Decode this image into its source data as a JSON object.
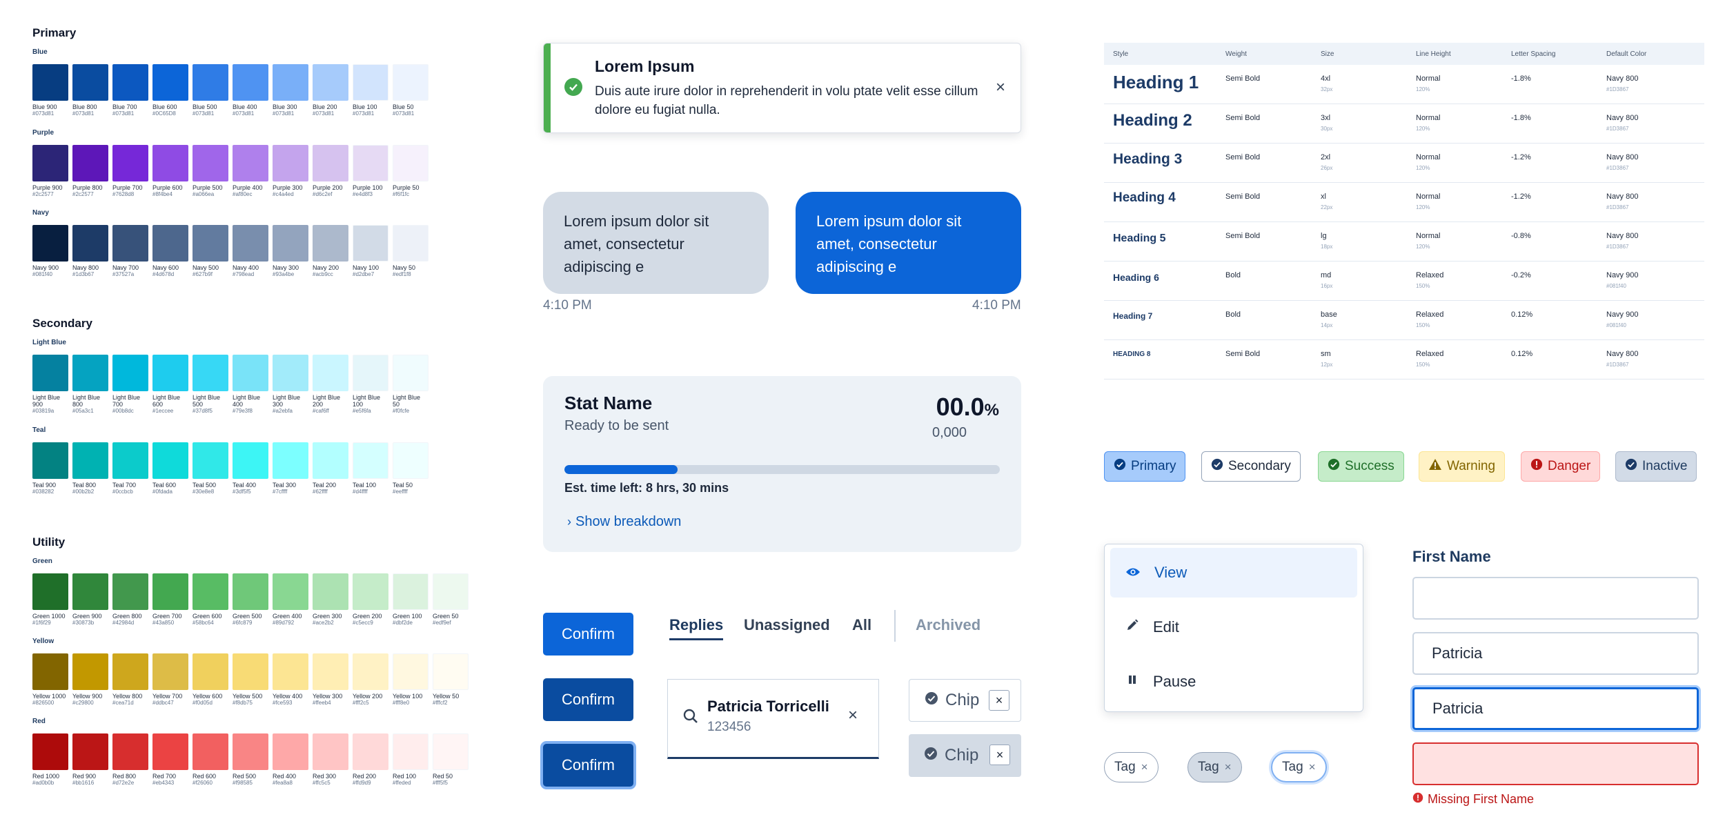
{
  "palette": {
    "primary_title": "Primary",
    "secondary_title": "Secondary",
    "utility_title": "Utility",
    "groups": {
      "blue": {
        "label": "Blue",
        "swatches": [
          {
            "name": "Blue 900",
            "hex": "#073d81",
            "color": "#073d81"
          },
          {
            "name": "Blue 800",
            "hex": "#073d81",
            "color": "#0a4ca0"
          },
          {
            "name": "Blue 700",
            "hex": "#073d81",
            "color": "#0c58c0"
          },
          {
            "name": "Blue 600",
            "hex": "#0C65D8",
            "color": "#0c65d8"
          },
          {
            "name": "Blue 500",
            "hex": "#073d81",
            "color": "#2f7ce6"
          },
          {
            "name": "Blue 400",
            "hex": "#073d81",
            "color": "#4f93f2"
          },
          {
            "name": "Blue 300",
            "hex": "#073d81",
            "color": "#79aff8"
          },
          {
            "name": "Blue 200",
            "hex": "#073d81",
            "color": "#a6cbfb"
          },
          {
            "name": "Blue 100",
            "hex": "#073d81",
            "color": "#d2e4fd"
          },
          {
            "name": "Blue 50",
            "hex": "#073d81",
            "color": "#ecf3fe"
          }
        ]
      },
      "purple": {
        "label": "Purple",
        "swatches": [
          {
            "name": "Purple 900",
            "hex": "#2c2577",
            "color": "#2c2577"
          },
          {
            "name": "Purple 800",
            "hex": "#2c2577",
            "color": "#5d17b8"
          },
          {
            "name": "Purple 700",
            "hex": "#7628d8",
            "color": "#7628d8"
          },
          {
            "name": "Purple 600",
            "hex": "#8f4be4",
            "color": "#8f4be4"
          },
          {
            "name": "Purple 500",
            "hex": "#a066ea",
            "color": "#a066ea"
          },
          {
            "name": "Purple 400",
            "hex": "#af80ec",
            "color": "#af80ec"
          },
          {
            "name": "Purple 300",
            "hex": "#c4a4ed",
            "color": "#c4a4ed"
          },
          {
            "name": "Purple 200",
            "hex": "#d6c2ef",
            "color": "#d6c2ef"
          },
          {
            "name": "Purple 100",
            "hex": "#e4d8f3",
            "color": "#e6daf4"
          },
          {
            "name": "Purple 50",
            "hex": "#f6f1fc",
            "color": "#f6f1fc"
          }
        ]
      },
      "navy": {
        "label": "Navy",
        "swatches": [
          {
            "name": "Navy 900",
            "hex": "#081f40",
            "color": "#081f40"
          },
          {
            "name": "Navy 800",
            "hex": "#1d3b67",
            "color": "#1d3b67"
          },
          {
            "name": "Navy 700",
            "hex": "#37527a",
            "color": "#37527a"
          },
          {
            "name": "Navy 600",
            "hex": "#4d678d",
            "color": "#4d678d"
          },
          {
            "name": "Navy 500",
            "hex": "#627b9f",
            "color": "#627b9f"
          },
          {
            "name": "Navy 400",
            "hex": "#798ead",
            "color": "#798ead"
          },
          {
            "name": "Navy 300",
            "hex": "#93a4be",
            "color": "#93a4be"
          },
          {
            "name": "Navy 200",
            "hex": "#acb9cc",
            "color": "#acb9cc"
          },
          {
            "name": "Navy 100",
            "hex": "#d2dbe7",
            "color": "#d2dbe7"
          },
          {
            "name": "Navy 50",
            "hex": "#edf1f8",
            "color": "#edf1f8"
          }
        ]
      },
      "lightblue": {
        "label": "Light Blue",
        "swatches": [
          {
            "name": "Light Blue 900",
            "hex": "#03819a",
            "color": "#0581a0"
          },
          {
            "name": "Light Blue 800",
            "hex": "#05a3c1",
            "color": "#05a3c1"
          },
          {
            "name": "Light Blue 700",
            "hex": "#00b8dc",
            "color": "#00b8dc"
          },
          {
            "name": "Light Blue 600",
            "hex": "#1eccee",
            "color": "#1eccee"
          },
          {
            "name": "Light Blue 500",
            "hex": "#37d8f5",
            "color": "#37d8f5"
          },
          {
            "name": "Light Blue 400",
            "hex": "#79e3f8",
            "color": "#79e3f8"
          },
          {
            "name": "Light Blue 300",
            "hex": "#a2ebfa",
            "color": "#a2ebfa"
          },
          {
            "name": "Light Blue 200",
            "hex": "#caf6ff",
            "color": "#caf6ff"
          },
          {
            "name": "Light Blue 100",
            "hex": "#e5f6fa",
            "color": "#e5f6fa"
          },
          {
            "name": "Light Blue 50",
            "hex": "#f0fcfe",
            "color": "#f0fcfe"
          }
        ]
      },
      "teal": {
        "label": "Teal",
        "swatches": [
          {
            "name": "Teal 900",
            "hex": "#038282",
            "color": "#038282"
          },
          {
            "name": "Teal 800",
            "hex": "#00b2b2",
            "color": "#00b2b2"
          },
          {
            "name": "Teal 700",
            "hex": "#0ccbcb",
            "color": "#0ccbcb"
          },
          {
            "name": "Teal 600",
            "hex": "#0fdada",
            "color": "#0fdada"
          },
          {
            "name": "Teal 500",
            "hex": "#30e8e8",
            "color": "#30e8e8"
          },
          {
            "name": "Teal 400",
            "hex": "#3df5f5",
            "color": "#3df5f5"
          },
          {
            "name": "Teal 300",
            "hex": "#7cffff",
            "color": "#7cffff"
          },
          {
            "name": "Teal 200",
            "hex": "#62ffff",
            "color": "#b2ffff"
          },
          {
            "name": "Teal 100",
            "hex": "#d4ffff",
            "color": "#d4ffff"
          },
          {
            "name": "Teal 50",
            "hex": "#eeffff",
            "color": "#eeffff"
          }
        ]
      },
      "green": {
        "label": "Green",
        "swatches": [
          {
            "name": "Green 1000",
            "hex": "#1f6f29",
            "color": "#1f6f29"
          },
          {
            "name": "Green 900",
            "hex": "#30873b",
            "color": "#30873b"
          },
          {
            "name": "Green 800",
            "hex": "#42984d",
            "color": "#42984d"
          },
          {
            "name": "Green 700",
            "hex": "#43a850",
            "color": "#43a850"
          },
          {
            "name": "Green 600",
            "hex": "#58bc64",
            "color": "#58bc64"
          },
          {
            "name": "Green 500",
            "hex": "#6fc879",
            "color": "#6fc879"
          },
          {
            "name": "Green 400",
            "hex": "#89d792",
            "color": "#89d792"
          },
          {
            "name": "Green 300",
            "hex": "#ace2b2",
            "color": "#ace2b2"
          },
          {
            "name": "Green 200",
            "hex": "#c5ecc9",
            "color": "#c5ecc9"
          },
          {
            "name": "Green 100",
            "hex": "#dbf2de",
            "color": "#dbf2de"
          },
          {
            "name": "Green 50",
            "hex": "#edf9ef",
            "color": "#edf9ef"
          }
        ]
      },
      "yellow": {
        "label": "Yellow",
        "swatches": [
          {
            "name": "Yellow 1000",
            "hex": "#826500",
            "color": "#826500"
          },
          {
            "name": "Yellow 900",
            "hex": "#c29800",
            "color": "#c29800"
          },
          {
            "name": "Yellow 800",
            "hex": "#cea71d",
            "color": "#cea71d"
          },
          {
            "name": "Yellow 700",
            "hex": "#ddbc47",
            "color": "#ddbc47"
          },
          {
            "name": "Yellow 600",
            "hex": "#f0d05d",
            "color": "#f0d05d"
          },
          {
            "name": "Yellow 500",
            "hex": "#f8db75",
            "color": "#f8db75"
          },
          {
            "name": "Yellow 400",
            "hex": "#fce593",
            "color": "#fce593"
          },
          {
            "name": "Yellow 300",
            "hex": "#ffeeb4",
            "color": "#ffeeb4"
          },
          {
            "name": "Yellow 200",
            "hex": "#fff2c5",
            "color": "#fff2c5"
          },
          {
            "name": "Yellow 100",
            "hex": "#fff8e0",
            "color": "#fff8e0"
          },
          {
            "name": "Yellow 50",
            "hex": "#fffcf2",
            "color": "#fffcf2"
          }
        ]
      },
      "red": {
        "label": "Red",
        "swatches": [
          {
            "name": "Red 1000",
            "hex": "#ad0b0b",
            "color": "#ad0b0b"
          },
          {
            "name": "Red 900",
            "hex": "#bb1616",
            "color": "#bb1616"
          },
          {
            "name": "Red 800",
            "hex": "#d72e2e",
            "color": "#d72e2e"
          },
          {
            "name": "Red 700",
            "hex": "#eb4343",
            "color": "#eb4343"
          },
          {
            "name": "Red 600",
            "hex": "#f26060",
            "color": "#f26060"
          },
          {
            "name": "Red 500",
            "hex": "#f98585",
            "color": "#f98585"
          },
          {
            "name": "Red 400",
            "hex": "#fea8a8",
            "color": "#fea8a8"
          },
          {
            "name": "Red 300",
            "hex": "#ffc5c5",
            "color": "#ffc5c5"
          },
          {
            "name": "Red 200",
            "hex": "#ffd9d9",
            "color": "#ffd9d9"
          },
          {
            "name": "Red 100",
            "hex": "#ffeded",
            "color": "#ffeded"
          },
          {
            "name": "Red 50",
            "hex": "#fff5f5",
            "color": "#fff5f5"
          }
        ]
      }
    }
  },
  "toast": {
    "title": "Lorem Ipsum",
    "body": "Duis aute irure dolor in reprehenderit in volu ptate velit esse cillum dolore eu fugiat nulla.",
    "close": "×"
  },
  "chat": {
    "incoming": "Lorem ipsum dolor sit amet, consectetur adipiscing e",
    "outgoing": "Lorem ipsum dolor sit amet, consectetur adipiscing e",
    "incoming_time": "4:10 PM",
    "outgoing_time": "4:10 PM"
  },
  "stat": {
    "name": "Stat Name",
    "status": "Ready to be sent",
    "value": "00.0",
    "unit": "%",
    "subvalue": "0,000",
    "progress": 0.26,
    "eta": "Est. time left: 8 hrs, 30 mins",
    "breakdown": "Show breakdown"
  },
  "buttons": {
    "confirm1": "Confirm",
    "confirm2": "Confirm",
    "confirm3": "Confirm"
  },
  "tabs": {
    "replies": "Replies",
    "unassigned": "Unassigned",
    "all": "All",
    "archived": "Archived"
  },
  "search": {
    "name": "Patricia Torricelli",
    "id": "123456",
    "clear": "×"
  },
  "chips": {
    "chip1": "Chip",
    "chip2": "Chip",
    "remove": "×"
  },
  "typography": {
    "headers": [
      "Style",
      "Weight",
      "Size",
      "Line Height",
      "Letter Spacing",
      "Default Color"
    ],
    "rows": [
      {
        "style": "Heading 1",
        "weight": "Semi Bold",
        "size": "4xl",
        "size_px": "32px",
        "lh": "Normal",
        "lh_pct": "120%",
        "ls": "-1.8%",
        "color": "Navy 800",
        "color_hex": "#1D3867"
      },
      {
        "style": "Heading 2",
        "weight": "Semi Bold",
        "size": "3xl",
        "size_px": "30px",
        "lh": "Normal",
        "lh_pct": "120%",
        "ls": "-1.8%",
        "color": "Navy 800",
        "color_hex": "#1D3867"
      },
      {
        "style": "Heading 3",
        "weight": "Semi Bold",
        "size": "2xl",
        "size_px": "26px",
        "lh": "Normal",
        "lh_pct": "120%",
        "ls": "-1.2%",
        "color": "Navy 800",
        "color_hex": "#1D3867"
      },
      {
        "style": "Heading 4",
        "weight": "Semi Bold",
        "size": "xl",
        "size_px": "22px",
        "lh": "Normal",
        "lh_pct": "120%",
        "ls": "-1.2%",
        "color": "Navy 800",
        "color_hex": "#1D3867"
      },
      {
        "style": "Heading 5",
        "weight": "Semi Bold",
        "size": "lg",
        "size_px": "18px",
        "lh": "Normal",
        "lh_pct": "120%",
        "ls": "-0.8%",
        "color": "Navy 800",
        "color_hex": "#1D3867"
      },
      {
        "style": "Heading 6",
        "weight": "Bold",
        "size": "md",
        "size_px": "16px",
        "lh": "Relaxed",
        "lh_pct": "150%",
        "ls": "-0.2%",
        "color": "Navy 900",
        "color_hex": "#081f40"
      },
      {
        "style": "Heading 7",
        "weight": "Bold",
        "size": "base",
        "size_px": "14px",
        "lh": "Relaxed",
        "lh_pct": "150%",
        "ls": "0.12%",
        "color": "Navy 900",
        "color_hex": "#081f40"
      },
      {
        "style": "HEADING 8",
        "weight": "Semi Bold",
        "size": "sm",
        "size_px": "12px",
        "lh": "Relaxed",
        "lh_pct": "150%",
        "ls": "0.12%",
        "color": "Navy 800",
        "color_hex": "#1D3867"
      }
    ]
  },
  "badges": {
    "primary": "Primary",
    "secondary": "Secondary",
    "success": "Success",
    "warning": "Warning",
    "danger": "Danger",
    "inactive": "Inactive"
  },
  "menu": {
    "view": "View",
    "edit": "Edit",
    "pause": "Pause"
  },
  "tags": {
    "tag1": "Tag",
    "tag2": "Tag",
    "tag3": "Tag",
    "remove": "×"
  },
  "form": {
    "label": "First Name",
    "field1": "",
    "field2": "Patricia",
    "field3": "Patricia",
    "field4": "",
    "error": "Missing First Name"
  },
  "colors": {
    "accent": "#0c65d8",
    "success": "#4caf50",
    "danger": "#d72e2e",
    "navy": "#1d3b67"
  }
}
